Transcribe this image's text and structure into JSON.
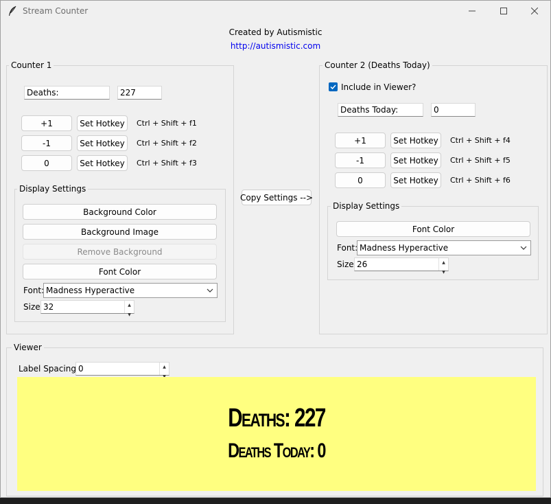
{
  "window": {
    "title": "Stream Counter",
    "accent": "#0067c0",
    "preview_bg": "#ffff80"
  },
  "header": {
    "created_by": "Created by Autismistic",
    "url": "http://autismistic.com"
  },
  "counter1": {
    "legend": "Counter 1",
    "label_value": "Deaths:",
    "count_value": "227",
    "buttons": [
      {
        "value": "+1",
        "hotkey_label": "Set Hotkey",
        "hotkey": "Ctrl + Shift + f1"
      },
      {
        "value": "-1",
        "hotkey_label": "Set Hotkey",
        "hotkey": "Ctrl + Shift + f2"
      },
      {
        "value": "0",
        "hotkey_label": "Set Hotkey",
        "hotkey": "Ctrl + Shift + f3"
      }
    ],
    "display": {
      "legend": "Display Settings",
      "background_color": "Background Color",
      "background_image": "Background Image",
      "remove_background": "Remove Background",
      "font_color": "Font Color",
      "font_label": "Font:",
      "font_value": "Madness Hyperactive",
      "size_label": "Size:",
      "size_value": "32"
    }
  },
  "copy_settings": "Copy Settings -->",
  "counter2": {
    "legend": "Counter 2 (Deaths Today)",
    "include_label": "Include in Viewer?",
    "include_checked": true,
    "label_value": "Deaths Today:",
    "count_value": "0",
    "buttons": [
      {
        "value": "+1",
        "hotkey_label": "Set Hotkey",
        "hotkey": "Ctrl + Shift + f4"
      },
      {
        "value": "-1",
        "hotkey_label": "Set Hotkey",
        "hotkey": "Ctrl + Shift + f5"
      },
      {
        "value": "0",
        "hotkey_label": "Set Hotkey",
        "hotkey": "Ctrl + Shift + f6"
      }
    ],
    "display": {
      "legend": "Display Settings",
      "font_color": "Font Color",
      "font_label": "Font:",
      "font_value": "Madness Hyperactive",
      "size_label": "Size:",
      "size_value": "26"
    }
  },
  "viewer": {
    "legend": "Viewer",
    "spacing_label": "Label Spacing:",
    "spacing_value": "0",
    "line1": "Deaths: 227",
    "line2": "Deaths Today: 0"
  }
}
